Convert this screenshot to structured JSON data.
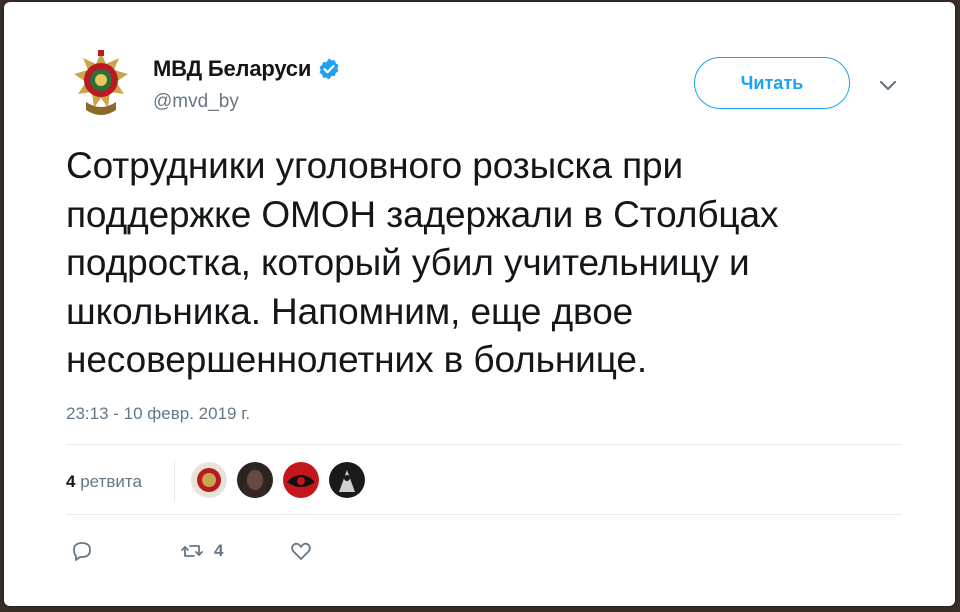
{
  "account": {
    "display_name": "МВД Беларуси",
    "handle": "@mvd_by",
    "avatar_icon": "police-emblem-icon",
    "verified_icon": "verified-badge-icon",
    "verified_color": "#1da1f2"
  },
  "header": {
    "follow_label": "Читать",
    "more_icon": "chevron-down-icon"
  },
  "tweet": {
    "lines": [
      "Сотрудники уголовного розыска при",
      "поддержке ОМОН задержали в Столбцах",
      "подростка, который убил учительницу и",
      "школьника. Напомним, еще двое",
      "несовершеннолетних в больнице."
    ],
    "timestamp": "23:13 - 10 февр. 2019 г."
  },
  "stats": {
    "retweet_count": "4",
    "retweet_label": "ретвита"
  },
  "actions": {
    "reply_icon": "reply-icon",
    "retweet_icon": "retweet-icon",
    "retweet_count": "4",
    "like_icon": "heart-icon"
  },
  "colors": {
    "accent": "#1da1f2",
    "text": "#14171a",
    "muted": "#657786"
  }
}
